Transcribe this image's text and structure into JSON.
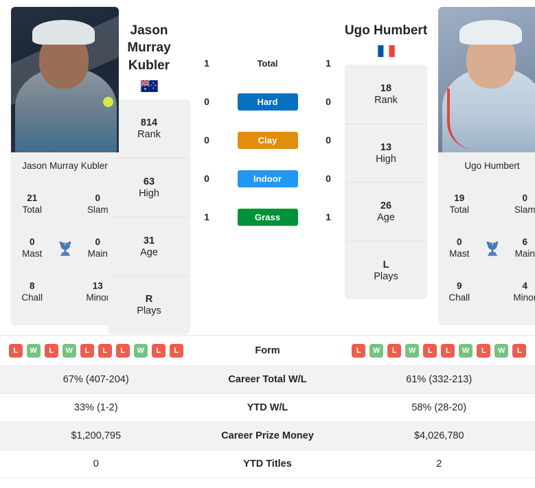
{
  "players": {
    "left": {
      "headline_name": "Jason\nMurray\nKubler",
      "name_line1": "Jason",
      "name_line2": "Murray",
      "name_line3": "Kubler",
      "flag": "australia-flag",
      "card_name": "Jason Murray Kubler",
      "photo": "jason-murray-kubler-photo",
      "titles": {
        "total_value": "21",
        "total_label": "Total",
        "slam_value": "0",
        "slam_label": "Slam",
        "mast_value": "0",
        "mast_label": "Mast",
        "main_value": "0",
        "main_label": "Main",
        "chall_value": "8",
        "chall_label": "Chall",
        "minor_value": "13",
        "minor_label": "Minor"
      },
      "stats": [
        {
          "value": "814",
          "label": "Rank"
        },
        {
          "value": "63",
          "label": "High"
        },
        {
          "value": "31",
          "label": "Age"
        },
        {
          "value": "R",
          "label": "Plays"
        }
      ],
      "form": [
        "L",
        "W",
        "L",
        "W",
        "L",
        "L",
        "L",
        "W",
        "L",
        "L"
      ]
    },
    "right": {
      "headline_name": "Ugo Humbert",
      "flag": "france-flag",
      "card_name": "Ugo Humbert",
      "photo": "ugo-humbert-photo",
      "titles": {
        "total_value": "19",
        "total_label": "Total",
        "slam_value": "0",
        "slam_label": "Slam",
        "mast_value": "0",
        "mast_label": "Mast",
        "main_value": "6",
        "main_label": "Main",
        "chall_value": "9",
        "chall_label": "Chall",
        "minor_value": "4",
        "minor_label": "Minor"
      },
      "stats": [
        {
          "value": "18",
          "label": "Rank"
        },
        {
          "value": "13",
          "label": "High"
        },
        {
          "value": "26",
          "label": "Age"
        },
        {
          "value": "L",
          "label": "Plays"
        }
      ],
      "form": [
        "L",
        "W",
        "L",
        "W",
        "L",
        "L",
        "W",
        "L",
        "W",
        "L"
      ]
    }
  },
  "head_to_head": [
    {
      "label": "Total",
      "left": "1",
      "right": "1",
      "badge": false,
      "color": ""
    },
    {
      "label": "Hard",
      "left": "0",
      "right": "0",
      "badge": true,
      "color": "#0570c0"
    },
    {
      "label": "Clay",
      "left": "0",
      "right": "0",
      "badge": true,
      "color": "#e08e0b"
    },
    {
      "label": "Indoor",
      "left": "0",
      "right": "0",
      "badge": true,
      "color": "#2196f3"
    },
    {
      "label": "Grass",
      "left": "1",
      "right": "1",
      "badge": true,
      "color": "#00913a"
    }
  ],
  "comparison_rows": [
    {
      "label": "Form",
      "left": "",
      "right": "",
      "type": "form"
    },
    {
      "label": "Career Total W/L",
      "left": "67% (407-204)",
      "right": "61% (332-213)",
      "type": "text"
    },
    {
      "label": "YTD W/L",
      "left": "33% (1-2)",
      "right": "58% (28-20)",
      "type": "text"
    },
    {
      "label": "Career Prize Money",
      "left": "$1,200,795",
      "right": "$4,026,780",
      "type": "text"
    },
    {
      "label": "YTD Titles",
      "left": "0",
      "right": "2",
      "type": "text"
    }
  ],
  "colors": {
    "hard": "#0570c0",
    "clay": "#e08e0b",
    "indoor": "#2196f3",
    "grass": "#00913a",
    "win_badge": "#77c281",
    "loss_badge": "#ef5b4c",
    "trophy": "#4a7ab5",
    "card_bg": "#f0f0f0",
    "row_shaded": "#f2f2f2"
  }
}
